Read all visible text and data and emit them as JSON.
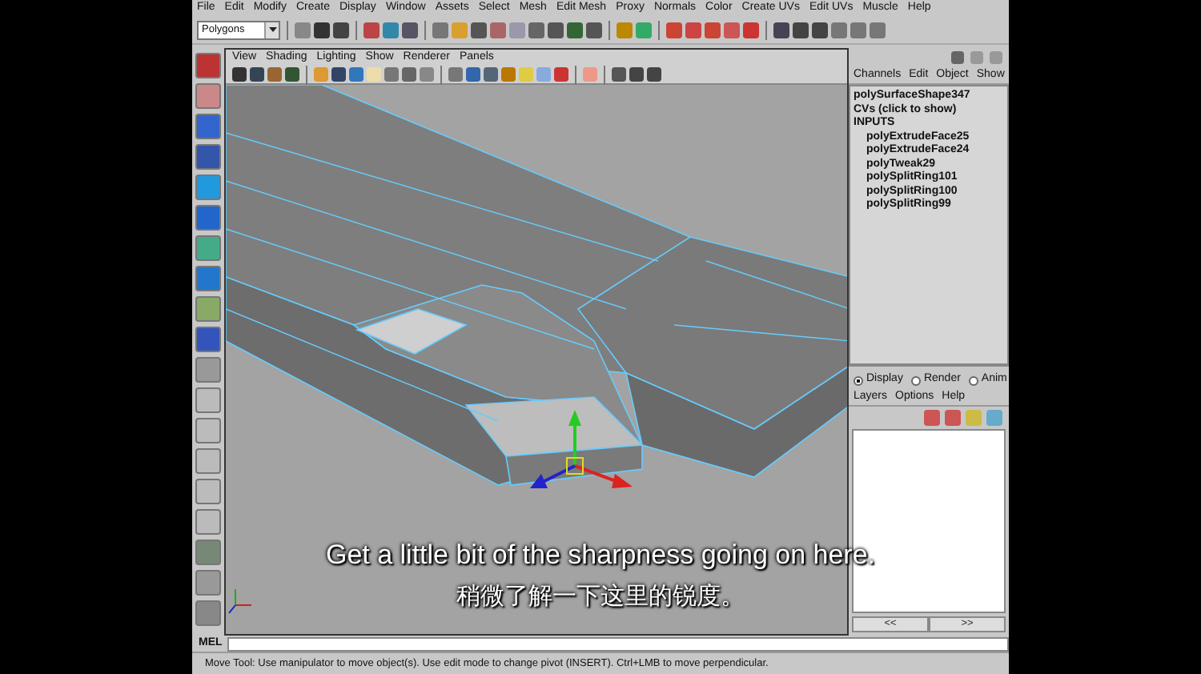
{
  "menubar": [
    "File",
    "Edit",
    "Modify",
    "Create",
    "Display",
    "Window",
    "Assets",
    "Select",
    "Mesh",
    "Edit Mesh",
    "Proxy",
    "Normals",
    "Color",
    "Create UVs",
    "Edit UVs",
    "Muscle",
    "Help"
  ],
  "toolbar": {
    "mode_dropdown": "Polygons"
  },
  "viewport": {
    "menu": [
      "View",
      "Shading",
      "Lighting",
      "Show",
      "Renderer",
      "Panels"
    ]
  },
  "channel_box": {
    "menu": [
      "Channels",
      "Edit",
      "Object",
      "Show"
    ],
    "object": "polySurfaceShape347",
    "cvs": "CVs (click to show)",
    "inputs_header": "INPUTS",
    "inputs": [
      "polyExtrudeFace25",
      "polyExtrudeFace24",
      "polyTweak29",
      "polySplitRing101",
      "polySplitRing100",
      "polySplitRing99"
    ]
  },
  "layer_editor": {
    "modes": [
      {
        "label": "Display",
        "selected": true
      },
      {
        "label": "Render",
        "selected": false
      },
      {
        "label": "Anim",
        "selected": false
      }
    ],
    "menu": [
      "Layers",
      "Options",
      "Help"
    ],
    "nav": [
      "<<",
      ">>"
    ]
  },
  "command_line": {
    "label": "MEL"
  },
  "help_line": "Move Tool: Use manipulator to move object(s). Use edit mode to change pivot (INSERT). Ctrl+LMB to move perpendicular.",
  "subtitles": [
    "Get a little bit of the sharpness going on here.",
    "稍微了解一下这里的锐度。"
  ]
}
